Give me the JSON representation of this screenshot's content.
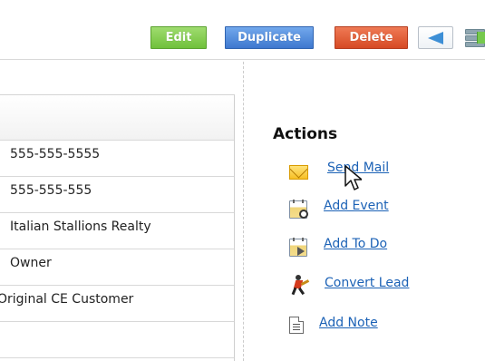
{
  "toolbar": {
    "edit_label": "Edit",
    "duplicate_label": "Duplicate",
    "delete_label": "Delete",
    "previous_icon": "left-arrow-icon",
    "more_icon": "list-view-icon"
  },
  "details": {
    "rows": [
      {
        "value": "555-555-5555"
      },
      {
        "value": "555-555-555"
      },
      {
        "value": "Italian Stallions Realty"
      },
      {
        "value": "Owner"
      },
      {
        "value": "Original CE Customer"
      },
      {
        "value": ""
      }
    ]
  },
  "actions": {
    "title": "Actions",
    "items": [
      {
        "label": "Send Mail",
        "icon": "mail-icon"
      },
      {
        "label": "Add Event",
        "icon": "calendar-event-icon"
      },
      {
        "label": "Add To Do",
        "icon": "calendar-todo-icon"
      },
      {
        "label": "Convert Lead",
        "icon": "running-person-icon"
      },
      {
        "label": "Add Note",
        "icon": "note-icon"
      }
    ]
  },
  "colors": {
    "edit": "#70c13b",
    "duplicate": "#3e78cf",
    "delete": "#d64a24",
    "link": "#1c62b6"
  }
}
